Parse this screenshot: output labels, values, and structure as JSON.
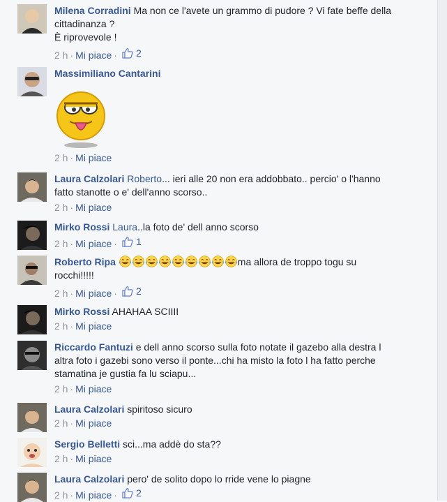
{
  "comments": [
    {
      "author": "Milena Corradini",
      "lines": [
        "Ma non ce l'avete un grammo di pudore ? Vi fate beffe della",
        "cittadinanza ?",
        "È riprovevole !"
      ],
      "time": "2 h",
      "action": "Mi piace",
      "likes": "2"
    },
    {
      "author": "Massimiliano Cantarini",
      "time": "2 h",
      "action": "Mi piace"
    },
    {
      "author": "Laura Calzolari",
      "mention": "Roberto",
      "text_line1": "... ieri alle 20 non era addobbato.. percio' o l'hanno",
      "text_line2": "fatto stanotte o e' dell'anno scorso..",
      "time": "2 h",
      "action": "Mi piace"
    },
    {
      "author": "Mirko Rossi",
      "mention": "Laura",
      "text": "..la foto de' dell anno scorso",
      "time": "2 h",
      "action": "Mi piace",
      "likes": "1"
    },
    {
      "author": "Roberto Ripa",
      "emoji_count": 9,
      "text_line1": "ma allora de troppo togu su",
      "text_line2": "rocchi!!!!!",
      "time": "2 h",
      "action": "Mi piace",
      "likes": "2"
    },
    {
      "author": "Mirko Rossi",
      "text": "AHAHAA SCIIII",
      "time": "2 h",
      "action": "Mi piace"
    },
    {
      "author": "Riccardo Fantuzi",
      "text_line1": "e dell anno scorso sulla foto notate il gazebo alla destra l",
      "text_line2": "altra foto i gazebi sono verso il ponte...chi ha misto la foto l ha fatto perche",
      "text_line3": "stamatina je gustia fa lu sciapu...",
      "time": "2 h",
      "action": "Mi piace"
    },
    {
      "author": "Laura Calzolari",
      "text": "spiritoso sicuro",
      "time": "2 h",
      "action": "Mi piace"
    },
    {
      "author": "Sergio Belletti",
      "text": "sci...ma addè do sta??",
      "time": "2 h",
      "action": "Mi piace"
    },
    {
      "author": "Laura Calzolari",
      "text": "pero' de solito dopo lo rride vene lo piagne",
      "time": "2 h",
      "action": "Mi piace",
      "likes": "2"
    }
  ],
  "colors": {
    "author": "#365899",
    "meta": "#90949c",
    "background": "#f6f7f9"
  }
}
